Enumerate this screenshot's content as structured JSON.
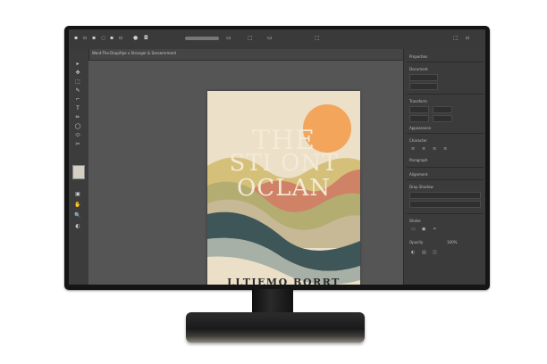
{
  "menubar": {
    "icons": [
      "▪",
      "▫",
      "▪",
      "◌",
      "▪",
      "▫",
      "●",
      "◘",
      "▭",
      "⬚",
      "▭",
      "⬚",
      "⬚"
    ]
  },
  "document_tab": {
    "label": "Word-The-Drapifipe x Stranger & Sessemrment"
  },
  "toolbar": {
    "tools": [
      "▸",
      "✥",
      "⬚",
      "✎",
      "⌐",
      "T",
      "✏",
      "◯",
      "⬭",
      "✂",
      "▣",
      "✋",
      "🔍",
      "◐"
    ]
  },
  "book": {
    "title_lines": [
      "THE",
      "STI ONT",
      "OCLAN"
    ],
    "author": "LLTIEMO BORRT"
  },
  "panel": {
    "header": "Properties",
    "labels": [
      "Document",
      "Transform",
      "Appearance",
      "Character",
      "Paragraph",
      "Alignment",
      "Drop Shadow",
      "Stroke",
      "Opacity"
    ],
    "field_value": "100%"
  },
  "colors": {
    "screen_bg": "#535353",
    "panel_bg": "#3b3b3b",
    "cover_bg": "#ece0c9",
    "sun": "#f2a55b",
    "teal": "#3f5658"
  }
}
